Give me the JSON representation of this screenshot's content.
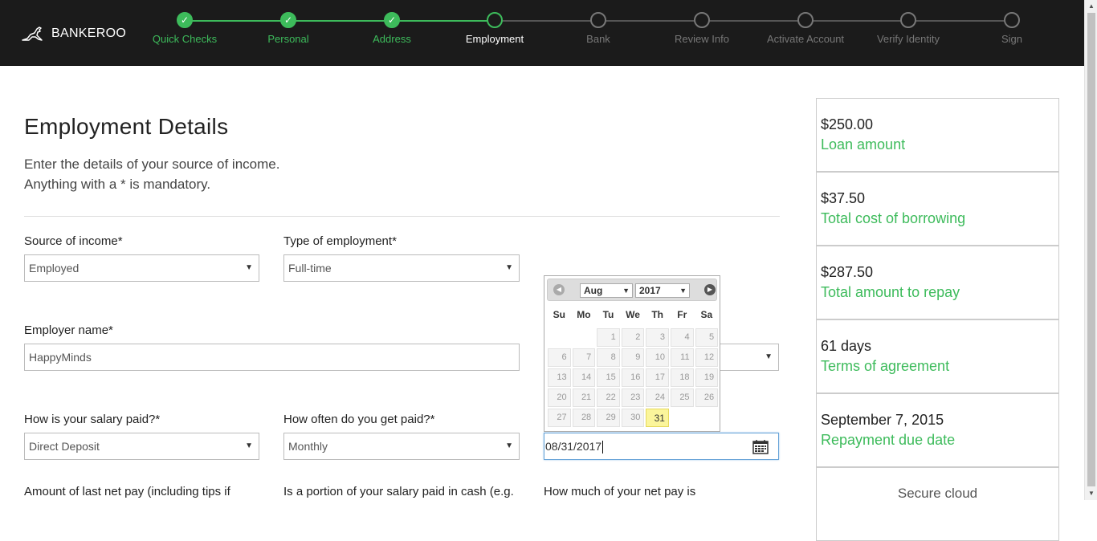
{
  "brand": {
    "name": "BANKEROO",
    "accent": "#3dbb5b",
    "header_bg": "#1b1b1b"
  },
  "steps": [
    {
      "label": "Quick Checks",
      "status": "done"
    },
    {
      "label": "Personal",
      "status": "done"
    },
    {
      "label": "Address",
      "status": "done"
    },
    {
      "label": "Employment",
      "status": "current"
    },
    {
      "label": "Bank",
      "status": "pending"
    },
    {
      "label": "Review Info",
      "status": "pending"
    },
    {
      "label": "Activate Account",
      "status": "pending"
    },
    {
      "label": "Verify Identity",
      "status": "pending"
    },
    {
      "label": "Sign",
      "status": "pending"
    }
  ],
  "page": {
    "title": "Employment Details",
    "intro_line1": "Enter the details of your source of income.",
    "intro_line2": "Anything with a * is mandatory."
  },
  "form": {
    "source_label": "Source of income*",
    "source_value": "Employed",
    "type_label": "Type of employment*",
    "type_value": "Full-time",
    "employer_label": "Employer name*",
    "employer_value": "HappyMinds",
    "salary_paid_label": "How is your salary paid?*",
    "salary_paid_value": "Direct Deposit",
    "frequency_label": "How often do you get paid?*",
    "frequency_value": "Monthly",
    "next_pay_value": "08/31/2017",
    "last_net_pay_label": "Amount of last net pay (including tips if",
    "cash_portion_label": "Is a portion of your salary paid in cash (e.g.",
    "net_pay_portion_label": "How much of your net pay is"
  },
  "datepicker": {
    "month": "Aug",
    "year": "2017",
    "weekdays": [
      "Su",
      "Mo",
      "Tu",
      "We",
      "Th",
      "Fr",
      "Sa"
    ],
    "leading_blanks": 2,
    "days": [
      "1",
      "2",
      "3",
      "4",
      "5",
      "6",
      "7",
      "8",
      "9",
      "10",
      "11",
      "12",
      "13",
      "14",
      "15",
      "16",
      "17",
      "18",
      "19",
      "20",
      "21",
      "22",
      "23",
      "24",
      "25",
      "26",
      "27",
      "28",
      "29",
      "30",
      "31"
    ],
    "selected": "31",
    "prev_icon": "chevron-left-icon",
    "next_icon": "chevron-right-icon"
  },
  "summary": [
    {
      "value": "$250.00",
      "label": "Loan amount"
    },
    {
      "value": "$37.50",
      "label": "Total cost of borrowing"
    },
    {
      "value": "$287.50",
      "label": "Total amount to repay"
    },
    {
      "value": "61 days",
      "label": "Terms of agreement"
    },
    {
      "value": "September 7, 2015",
      "label": "Repayment due date"
    }
  ],
  "secure_text": "Secure cloud"
}
